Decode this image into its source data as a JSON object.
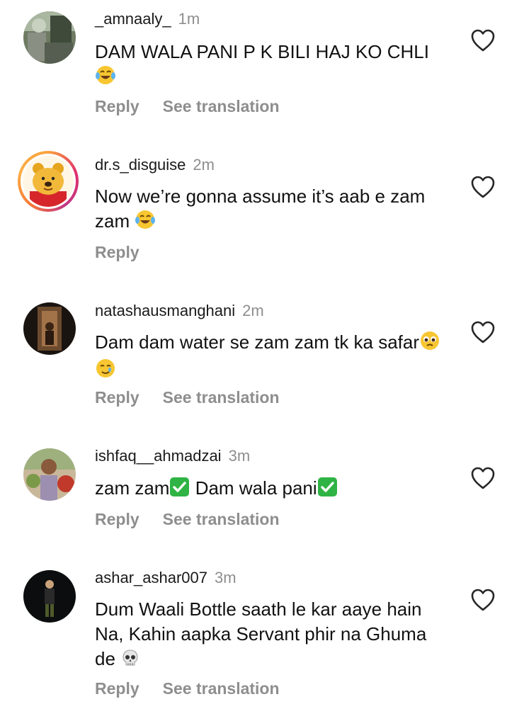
{
  "comments": [
    {
      "username": "_amnaaly_",
      "time": "1m",
      "text": "DAM WALA PANI P K BILI HAJ KO CHLI",
      "emoji": "😂",
      "reply_label": "Reply",
      "translate_label": "See translation"
    },
    {
      "username": "dr.s_disguise",
      "time": "2m",
      "text": "Now we’re gonna assume it’s aab e zam zam",
      "emoji": "😂",
      "reply_label": "Reply"
    },
    {
      "username": "natashausmanghani",
      "time": "2m",
      "text": "Dam dam water se zam zam tk ka safar",
      "emoji": "🥹🥲",
      "reply_label": "Reply",
      "translate_label": "See translation"
    },
    {
      "username": "ishfaq__ahmadzai",
      "time": "3m",
      "text_part1": "zam zam",
      "text_part2": " Dam wala pani",
      "emoji": "✅",
      "reply_label": "Reply",
      "translate_label": "See translation"
    },
    {
      "username": "ashar_ashar007",
      "time": "3m",
      "text": "Dum Waali Bottle saath le kar aaye hain Na, Kahin aapka Servant phir na Ghuma de",
      "emoji": "💀",
      "reply_label": "Reply",
      "translate_label": "See translation"
    }
  ],
  "icons": {
    "like": "heart-outline-icon",
    "laugh": "face-with-tears-of-joy-emoji",
    "check": "check-mark-button-emoji",
    "skull": "skull-emoji"
  },
  "colors": {
    "text": "#111111",
    "muted": "#8e8e8e",
    "story_ring_start": "#f9a23c",
    "story_ring_end": "#e1306c",
    "check_green": "#2fb344"
  }
}
